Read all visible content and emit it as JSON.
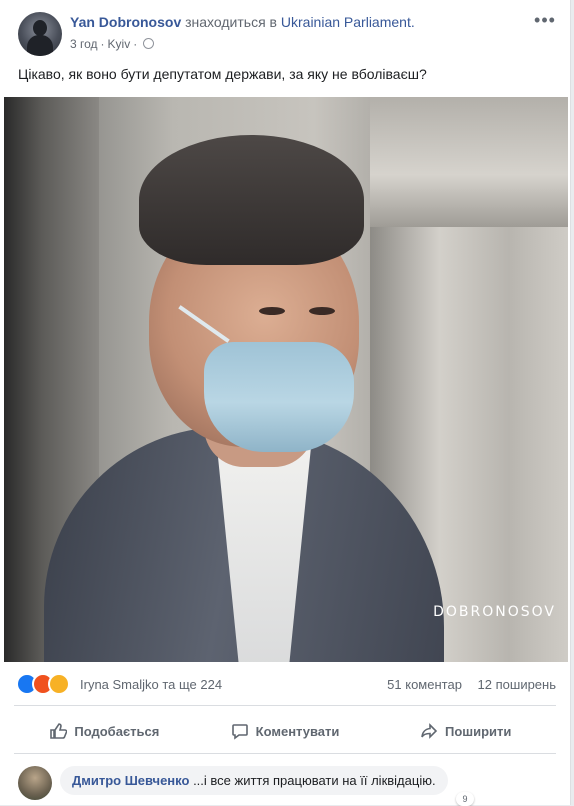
{
  "post": {
    "author": "Yan Dobronosov",
    "checkin_prefix": "знаходиться в",
    "place": "Ukrainian Parliament.",
    "time": "3 год",
    "location": "Kyiv",
    "text": "Цікаво, як воно бути депутатом держави, за яку не вболіваєш?",
    "photo_watermark": "DOBRONOSOV"
  },
  "reactions": {
    "summary": "Iryna Smaljko та ще 224",
    "comments": "51 коментар",
    "shares": "12 поширень",
    "icons": [
      "like-icon",
      "angry-icon",
      "sad-icon"
    ],
    "colors": {
      "like": "#1877f2",
      "angry": "#f0511e",
      "sad": "#f7b125"
    }
  },
  "actions": {
    "like": "Подобається",
    "comment": "Коментувати",
    "share": "Поширити"
  },
  "comment": {
    "author": "Дмитро Шевченко",
    "text": "...і все життя працювати на її ліквідацію.",
    "reaction_count": "9"
  }
}
